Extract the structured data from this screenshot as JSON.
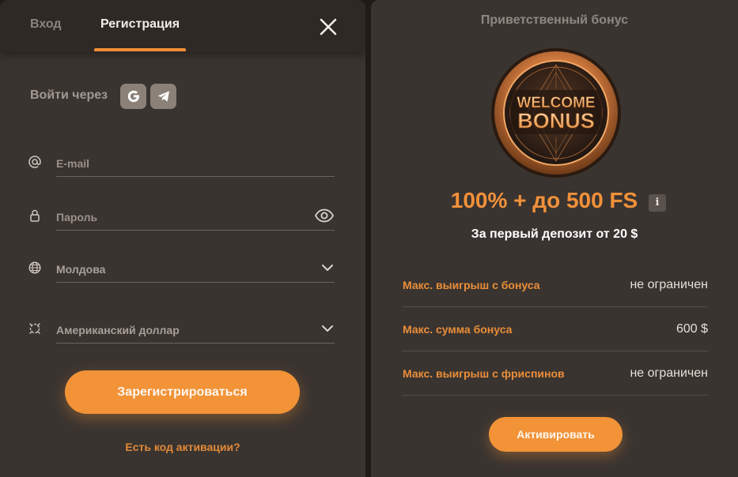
{
  "tabs": {
    "login": "Вход",
    "register": "Регистрация"
  },
  "social": {
    "label": "Войти через",
    "icons": [
      "google-icon",
      "telegram-icon"
    ]
  },
  "form": {
    "email_placeholder": "E-mail",
    "password_placeholder": "Пароль",
    "country_value": "Молдова",
    "currency_value": "Американский доллар"
  },
  "register_button": "Зарегистрироваться",
  "activation_link": "Есть код активации?",
  "bonus": {
    "title": "Приветственный бонус",
    "coin_line1": "WELCOME",
    "coin_line2": "BONUS",
    "amount": "100% + до 500 FS",
    "info_label": "i",
    "subtitle": "За первый депозит от 20 $",
    "rows": [
      {
        "label": "Макс. выигрыш с бонуса",
        "value": "не ограничен"
      },
      {
        "label": "Макс. сумма бонуса",
        "value": "600 $"
      },
      {
        "label": "Макс. выигрыш с фриспинов",
        "value": "не ограничен"
      }
    ],
    "activate_button": "Активировать"
  },
  "colors": {
    "accent": "#f29338",
    "panel": "#3a3430",
    "tabs_bar": "#2e2925",
    "background": "#1e1b18"
  }
}
